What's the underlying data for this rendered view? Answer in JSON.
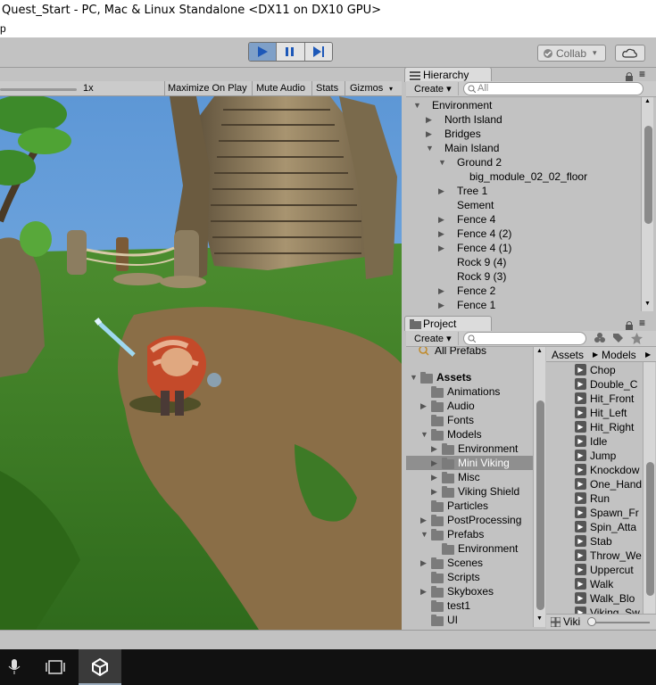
{
  "window": {
    "title": "Quest_Start - PC, Mac & Linux Standalone <DX11 on DX10 GPU>",
    "menu_fragment": "p"
  },
  "toolbar": {
    "collab_label": "Collab",
    "collab_caret": "▾"
  },
  "game": {
    "scale_label": "1x",
    "maximize_label": "Maximize On Play",
    "mute_label": "Mute Audio",
    "stats_label": "Stats",
    "gizmos_label": "Gizmos",
    "gizmos_caret": "▾"
  },
  "hierarchy": {
    "tab_label": "Hierarchy",
    "create_label": "Create ▾",
    "search_placeholder": "All",
    "items": [
      {
        "label": "Environment",
        "arrow": "▼"
      },
      {
        "label": "North Island",
        "arrow": "▶"
      },
      {
        "label": "Bridges",
        "arrow": "▶"
      },
      {
        "label": "Main Island",
        "arrow": "▼"
      },
      {
        "label": "Ground 2",
        "arrow": "▼"
      },
      {
        "label": "big_module_02_02_floor",
        "arrow": ""
      },
      {
        "label": "Tree 1",
        "arrow": "▶"
      },
      {
        "label": "Sement",
        "arrow": ""
      },
      {
        "label": "Fence 4",
        "arrow": "▶"
      },
      {
        "label": "Fence 4 (2)",
        "arrow": "▶"
      },
      {
        "label": "Fence 4 (1)",
        "arrow": "▶"
      },
      {
        "label": "Rock 9 (4)",
        "arrow": ""
      },
      {
        "label": "Rock 9 (3)",
        "arrow": ""
      },
      {
        "label": "Fence 2",
        "arrow": "▶"
      },
      {
        "label": "Fence 1",
        "arrow": "▶"
      }
    ]
  },
  "project": {
    "tab_label": "Project",
    "create_label": "Create ▾",
    "breadcrumb_assets": "Assets",
    "breadcrumb_sep": "▶",
    "breadcrumb_models": "Models",
    "favorites_partial": "All Prefabs",
    "tree": [
      {
        "label": "Assets",
        "arrow": "▼",
        "bold": true
      },
      {
        "label": "Animations",
        "arrow": ""
      },
      {
        "label": "Audio",
        "arrow": "▶"
      },
      {
        "label": "Fonts",
        "arrow": ""
      },
      {
        "label": "Models",
        "arrow": "▼"
      },
      {
        "label": "Environment",
        "arrow": "▶"
      },
      {
        "label": "Mini Viking",
        "arrow": "▶",
        "selected": true
      },
      {
        "label": "Misc",
        "arrow": "▶"
      },
      {
        "label": "Viking Shield",
        "arrow": "▶"
      },
      {
        "label": "Particles",
        "arrow": ""
      },
      {
        "label": "PostProcessing",
        "arrow": "▶"
      },
      {
        "label": "Prefabs",
        "arrow": "▼"
      },
      {
        "label": "Environment",
        "arrow": ""
      },
      {
        "label": "Scenes",
        "arrow": "▶"
      },
      {
        "label": "Scripts",
        "arrow": ""
      },
      {
        "label": "Skyboxes",
        "arrow": "▶"
      },
      {
        "label": "test1",
        "arrow": ""
      },
      {
        "label": "UI",
        "arrow": ""
      }
    ],
    "files": [
      "Chop",
      "Double_C",
      "Hit_Front",
      "Hit_Left",
      "Hit_Right",
      "Idle",
      "Jump",
      "Knockdow",
      "One_Hand",
      "Run",
      "Spawn_Fr",
      "Spin_Atta",
      "Stab",
      "Throw_We",
      "Uppercut",
      "Walk",
      "Walk_Blo",
      "Viking_Sw"
    ],
    "footer_label": "Viki"
  },
  "colors": {
    "selected_row": "#8f8f8f",
    "play_active": "#7fa0c8",
    "sky": "#6aa0d8",
    "grass": "#3d7a26"
  }
}
